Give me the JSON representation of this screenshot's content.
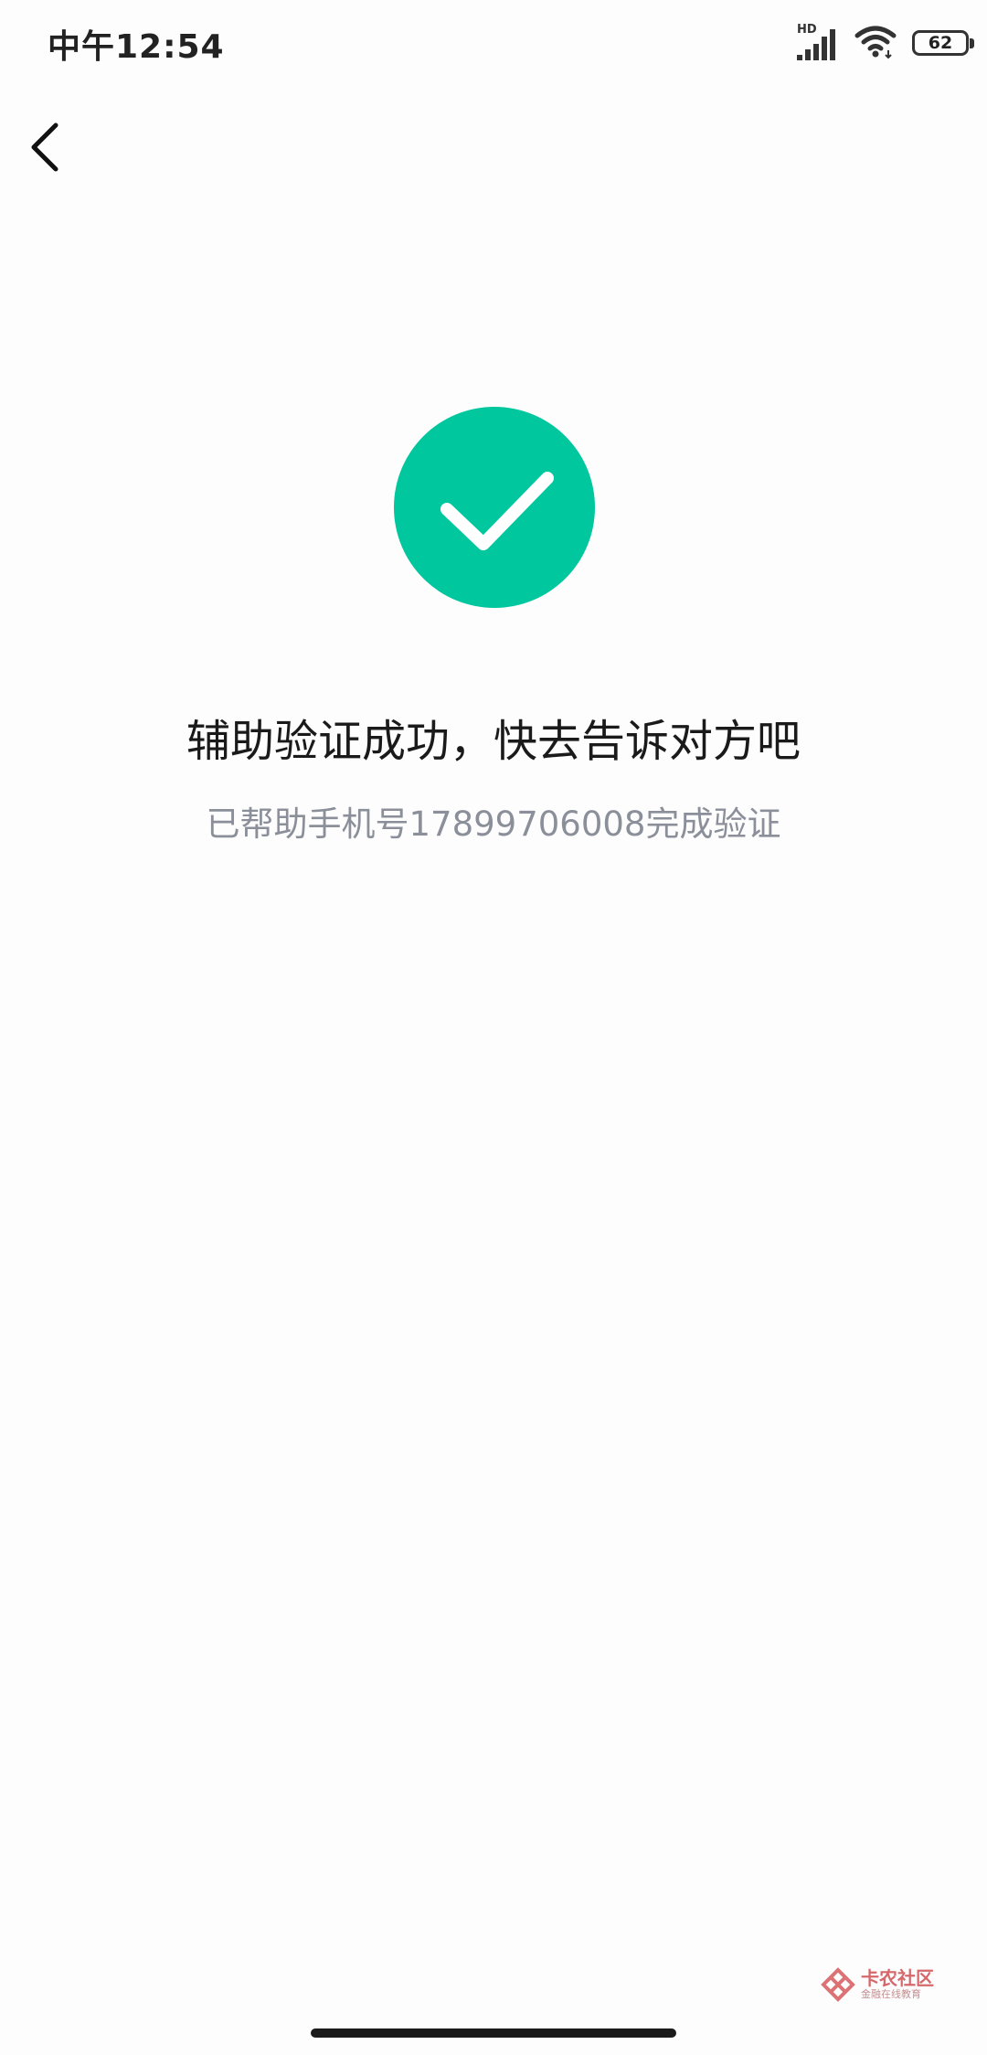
{
  "status_bar": {
    "time": "中午12:54",
    "network_label": "HD",
    "battery_level": "62",
    "icons": [
      "signal-icon",
      "wifi-icon",
      "battery-icon"
    ]
  },
  "nav": {
    "back_icon": "chevron-left-icon"
  },
  "result": {
    "icon": "check-circle-icon",
    "accent_color": "#00c79e",
    "title": "辅助验证成功，快去告诉对方吧",
    "subtitle": "已帮助手机号17899706008完成验证"
  },
  "watermark": {
    "main": "卡农社区",
    "sub": "金融在线教育"
  }
}
